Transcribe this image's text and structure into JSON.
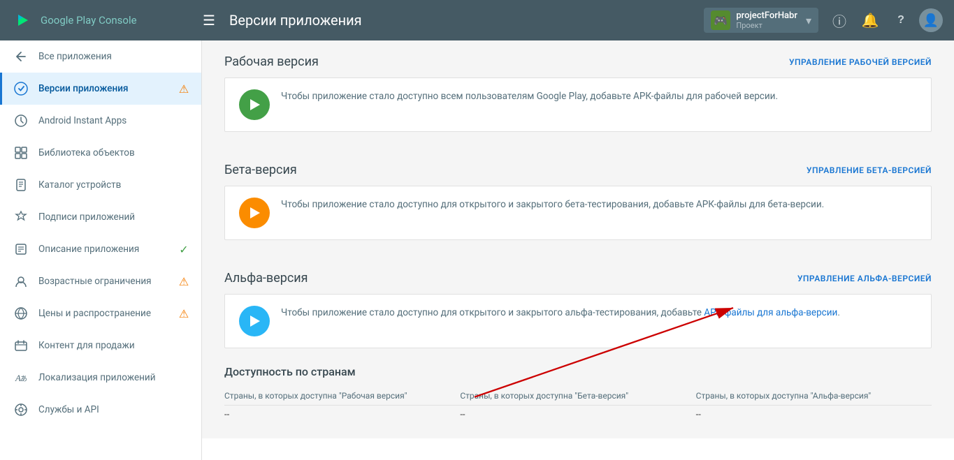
{
  "header": {
    "logo_text_normal": "Google Play",
    "logo_text_accent": "Console",
    "menu_icon": "☰",
    "title": "Версии приложения",
    "project_name": "projectForHabr",
    "project_sub": "Проект",
    "info_icon": "ℹ",
    "bell_icon": "🔔",
    "help_icon": "?",
    "avatar_icon": "👤"
  },
  "sidebar": {
    "items": [
      {
        "id": "all-apps",
        "label": "Все приложения",
        "icon": "←",
        "badge": null,
        "active": false
      },
      {
        "id": "app-versions",
        "label": "Версии приложения",
        "icon": "📱",
        "badge": "warning",
        "active": true
      },
      {
        "id": "instant-apps",
        "label": "Android Instant Apps",
        "icon": "⚡",
        "badge": null,
        "active": false
      },
      {
        "id": "asset-library",
        "label": "Библиотека объектов",
        "icon": "▦",
        "badge": null,
        "active": false
      },
      {
        "id": "device-catalog",
        "label": "Каталог устройств",
        "icon": "📋",
        "badge": null,
        "active": false
      },
      {
        "id": "app-signing",
        "label": "Подписи приложений",
        "icon": "🔑",
        "badge": null,
        "active": false
      },
      {
        "id": "app-description",
        "label": "Описание приложения",
        "icon": "📝",
        "badge": "success",
        "active": false
      },
      {
        "id": "age-ratings",
        "label": "Возрастные ограничения",
        "icon": "👶",
        "badge": "warning",
        "active": false
      },
      {
        "id": "pricing",
        "label": "Цены и распространение",
        "icon": "🌐",
        "badge": "warning",
        "active": false
      },
      {
        "id": "in-app-products",
        "label": "Контент для продажи",
        "icon": "💳",
        "badge": null,
        "active": false
      },
      {
        "id": "localization",
        "label": "Локализация приложений",
        "icon": "A",
        "badge": null,
        "active": false
      },
      {
        "id": "services-api",
        "label": "Службы и API",
        "icon": "⚙",
        "badge": null,
        "active": false
      }
    ]
  },
  "main": {
    "sections": [
      {
        "id": "production",
        "title": "Рабочая версия",
        "action_label": "УПРАВЛЕНИЕ РАБОЧЕЙ ВЕРСИЕЙ",
        "icon_color": "green",
        "text": "Чтобы приложение стало доступно всем пользователям Google Play, добавьте АРК-файлы для рабочей версии."
      },
      {
        "id": "beta",
        "title": "Бета-версия",
        "action_label": "УПРАВЛЕНИЕ БЕТА-ВЕРСИЕЙ",
        "icon_color": "orange",
        "text": "Чтобы приложение стало доступно для открытого и закрытого бета-тестирования, добавьте АРК-файлы для бета-версии."
      },
      {
        "id": "alpha",
        "title": "Альфа-версия",
        "action_label": "УПРАВЛЕНИЕ АЛЬФА-ВЕРСИЕЙ",
        "icon_color": "blue",
        "text_part1": "Чтобы приложение стало доступно для открытого и закрытого альфа-тестирования, добавьте ",
        "text_link": "АРК-файлы для альфа-версии",
        "text_part2": "."
      }
    ],
    "availability": {
      "title": "Доступность по странам",
      "columns": [
        {
          "header": "Страны, в которых доступна \"Рабочая версия\"",
          "value": "--"
        },
        {
          "header": "Страны, в которых доступна \"Бета-версия\"",
          "value": "--"
        },
        {
          "header": "Страны, в которых доступна \"Альфа-версия\"",
          "value": "--"
        }
      ]
    }
  }
}
